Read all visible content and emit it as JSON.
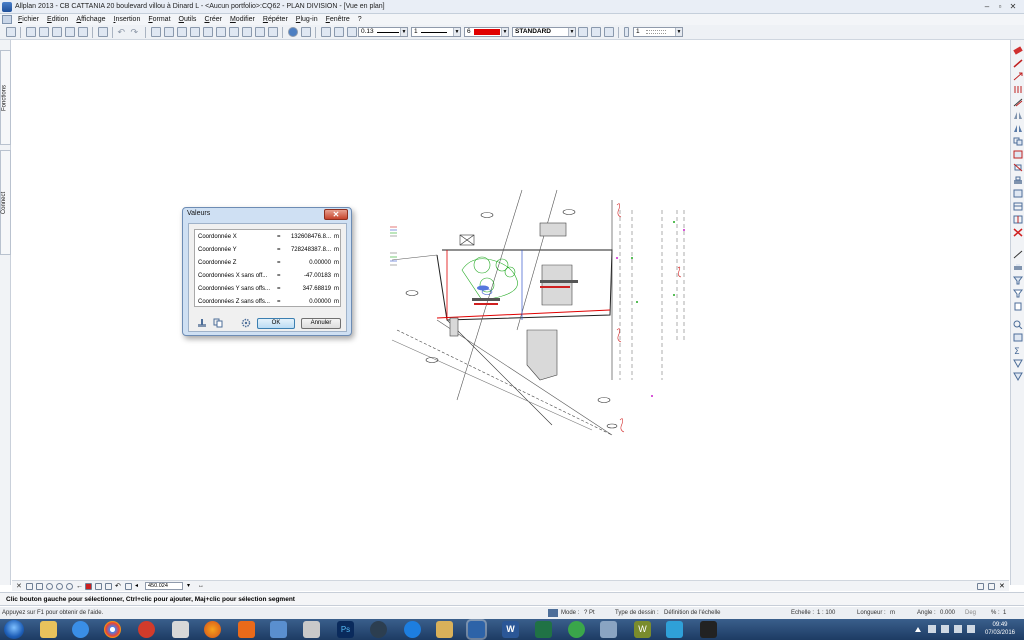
{
  "window": {
    "title": "Allplan 2013 - CB CATTANIA  20 boulevard villou à Dinard L - <Aucun portfolio>:CQ62 - PLAN DIVISION - [Vue en plan]",
    "controls": {
      "minimize": "–",
      "restore": "▫",
      "close": "✕"
    }
  },
  "menu": {
    "items": [
      "Fichier",
      "Edition",
      "Affichage",
      "Insertion",
      "Format",
      "Outils",
      "Créer",
      "Modifier",
      "Répéter",
      "Plug-in",
      "Fenêtre",
      "?"
    ]
  },
  "toolbar": {
    "pen_thickness": "0.13",
    "line_type": "1",
    "color_index": "6",
    "color_swatch": "#e00000",
    "layer": "STANDARD",
    "object_count": "1"
  },
  "left_panel": {
    "tabs": [
      "Fonctions",
      "Connect"
    ]
  },
  "dialog": {
    "title": "Valeurs",
    "close_label": "✕",
    "rows": [
      {
        "label": "Coordonnée X",
        "eq": "=",
        "value": "132608476.8...",
        "unit": "m"
      },
      {
        "label": "Coordonnée Y",
        "eq": "=",
        "value": "728248387.8...",
        "unit": "m"
      },
      {
        "label": "Coordonnée Z",
        "eq": "=",
        "value": "0.00000",
        "unit": "m"
      },
      {
        "label": "Coordonnées X sans off...",
        "eq": "=",
        "value": "-47.00183",
        "unit": "m"
      },
      {
        "label": "Coordonnées Y sans offs...",
        "eq": "=",
        "value": "347.68819",
        "unit": "m"
      },
      {
        "label": "Coordonnées Z sans offs...",
        "eq": "=",
        "value": "0.00000",
        "unit": "m"
      }
    ],
    "ok_label": "OK",
    "cancel_label": "Annuler"
  },
  "viewbar": {
    "scale_value": "450.024"
  },
  "prompt": {
    "text": "Clic bouton gauche pour sélectionner, Ctrl+clic pour ajouter, Maj+clic pour sélection segment"
  },
  "status": {
    "help": "Appuyez sur F1 pour obtenir de l'aide.",
    "mode_label": "Mode :",
    "mode_value": "? Pt",
    "type_label": "Type de dessin :",
    "type_value": "Définition de l'échelle",
    "scale_label": "Echelle :",
    "scale_value": "1 : 100",
    "length_label": "Longueur :",
    "length_unit": "m",
    "angle_label": "Angle :",
    "angle_value": "0.000",
    "angle_unit": "Deg",
    "percent_label": "% :",
    "percent_value": "1"
  },
  "taskbar": {
    "time": "09:49",
    "date": "07/03/2016"
  }
}
